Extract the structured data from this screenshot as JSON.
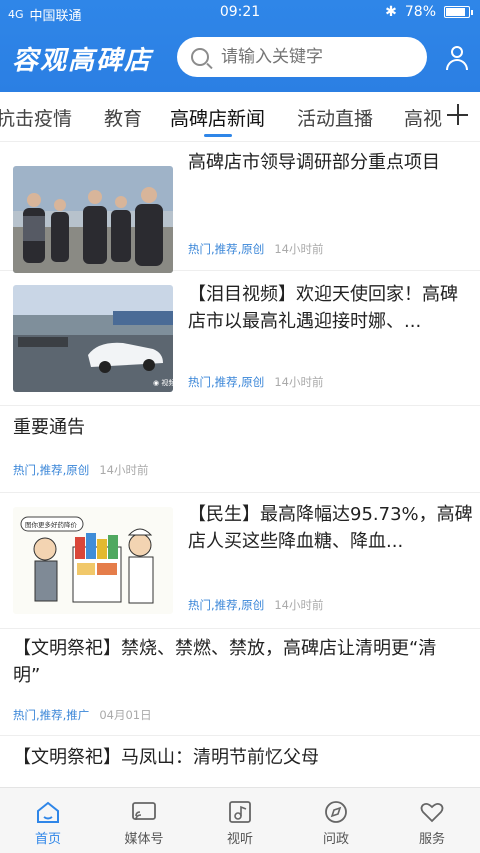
{
  "status": {
    "signal": "4G",
    "carrier": "中国联通",
    "time": "09:21",
    "battery": "78%",
    "battery_level": 0.78
  },
  "header": {
    "logo": "容观高碑店",
    "search_placeholder": "请输入关键字"
  },
  "tabs": [
    "抗击疫情",
    "教育",
    "高碑店新闻",
    "活动直播",
    "高视"
  ],
  "active_tab": "高碑店新闻",
  "feed": [
    {
      "title": "高碑店市领导调研部分重点项目",
      "tags": "热门,推荐,原创",
      "time": "14小时前"
    },
    {
      "title": "【泪目视频】欢迎天使回家！高碑店市以最高礼遇迎接时娜、...",
      "tags": "热门,推荐,原创",
      "time": "14小时前"
    },
    {
      "title": "重要通告",
      "tags": "热门,推荐,原创",
      "time": "14小时前"
    },
    {
      "title": "【民生】最高降幅达95.73%，高碑店人买这些降血糖、降血...",
      "tags": "热门,推荐,原创",
      "time": "14小时前"
    },
    {
      "title": "【文明祭祀】禁烧、禁燃、禁放，高碑店让清明更“清明”",
      "tags": "热门,推荐,推广",
      "time": "04月01日"
    },
    {
      "title": "【文明祭祀】马凤山：清明节前忆父母"
    }
  ],
  "bottom_nav": [
    {
      "label": "首页",
      "icon": "home-icon"
    },
    {
      "label": "媒体号",
      "icon": "cast-icon"
    },
    {
      "label": "视听",
      "icon": "music-icon"
    },
    {
      "label": "问政",
      "icon": "compass-icon"
    },
    {
      "label": "服务",
      "icon": "heart-icon"
    }
  ],
  "colors": {
    "brand": "#2f86e8",
    "tag": "#3a86d8"
  }
}
